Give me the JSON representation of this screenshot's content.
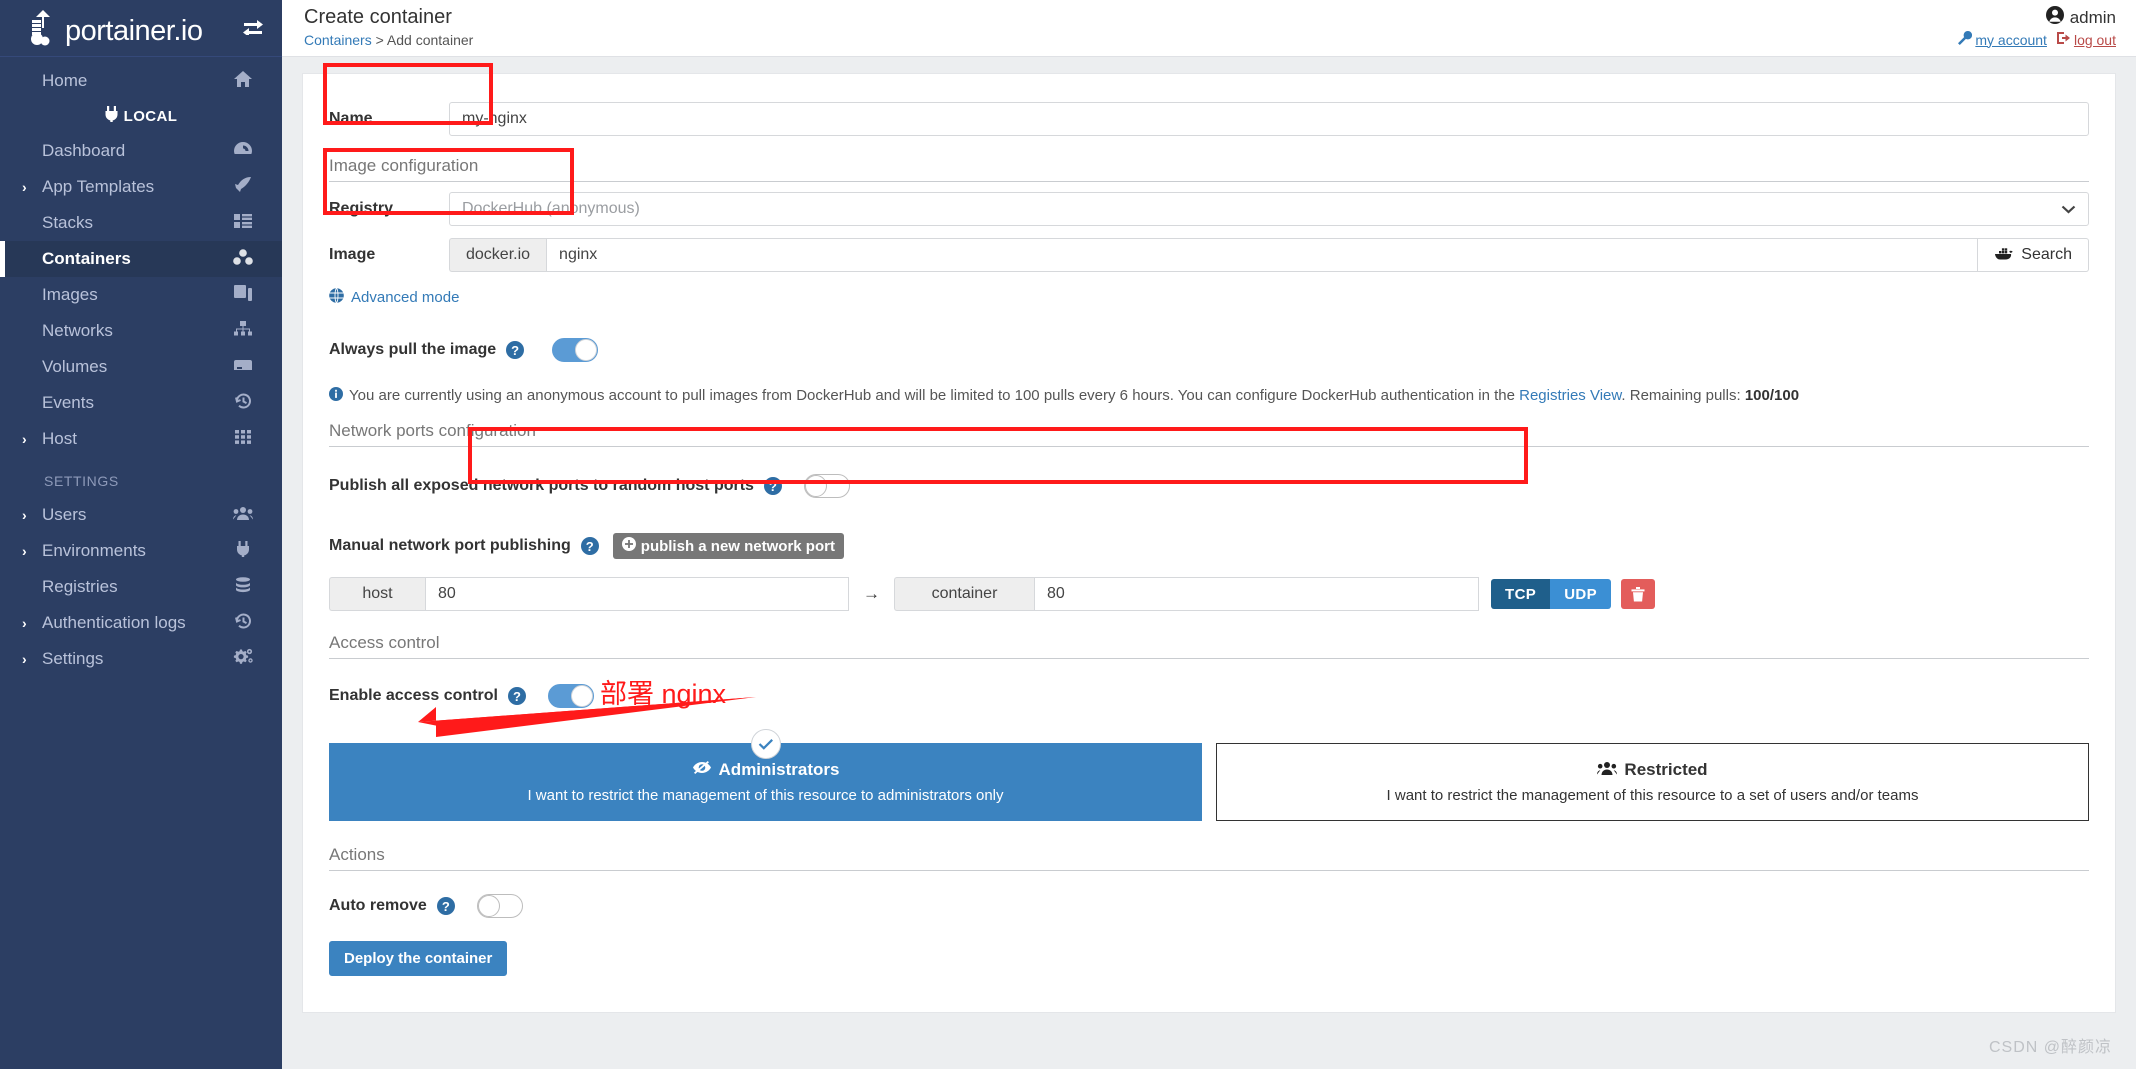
{
  "brand": {
    "name": "portainer.io",
    "toggle_icon": "collapse-arrows-icon"
  },
  "sidebar": {
    "items": [
      {
        "label": "Home",
        "icon": "home-icon",
        "caret": "",
        "active": false
      },
      {
        "label": "LOCAL",
        "icon": "plug-icon",
        "type": "environment"
      },
      {
        "label": "Dashboard",
        "icon": "dashboard-icon",
        "caret": "",
        "active": false
      },
      {
        "label": "App Templates",
        "icon": "rocket-icon",
        "caret": "›",
        "active": false
      },
      {
        "label": "Stacks",
        "icon": "stacks-icon",
        "caret": "",
        "active": false
      },
      {
        "label": "Containers",
        "icon": "containers-icon",
        "caret": "",
        "active": true
      },
      {
        "label": "Images",
        "icon": "images-icon",
        "caret": "",
        "active": false
      },
      {
        "label": "Networks",
        "icon": "networks-icon",
        "caret": "",
        "active": false
      },
      {
        "label": "Volumes",
        "icon": "volumes-icon",
        "caret": "",
        "active": false
      },
      {
        "label": "Events",
        "icon": "history-icon",
        "caret": "",
        "active": false
      },
      {
        "label": "Host",
        "icon": "grid-icon",
        "caret": "›",
        "active": false
      }
    ],
    "section_label": "SETTINGS",
    "settings_items": [
      {
        "label": "Users",
        "icon": "users-icon",
        "caret": "›"
      },
      {
        "label": "Environments",
        "icon": "plug-icon",
        "caret": "›"
      },
      {
        "label": "Registries",
        "icon": "database-icon",
        "caret": ""
      },
      {
        "label": "Authentication logs",
        "icon": "history-icon",
        "caret": "›"
      },
      {
        "label": "Settings",
        "icon": "gears-icon",
        "caret": "›"
      }
    ]
  },
  "header": {
    "title": "Create container",
    "breadcrumb_root": "Containers",
    "breadcrumb_sep": ">",
    "breadcrumb_current": "Add container",
    "user": "admin",
    "my_account": "my account",
    "log_out": "log out"
  },
  "form": {
    "name_label": "Name",
    "name_value": "my-nginx",
    "image_section": "Image configuration",
    "registry_label": "Registry",
    "registry_value": "DockerHub (anonymous)",
    "image_label": "Image",
    "image_prefix": "docker.io",
    "image_value": "nginx",
    "search_label": "Search",
    "advanced_mode": "Advanced mode",
    "always_pull_label": "Always pull the image",
    "always_pull_on": true,
    "info_text_1": "You are currently using an anonymous account to pull images from DockerHub and will be limited to 100 pulls every 6 hours. You can configure DockerHub authentication in the ",
    "info_link": "Registries View",
    "info_text_2": ". Remaining pulls: ",
    "info_pulls": "100/100"
  },
  "ports": {
    "section": "Network ports configuration",
    "publish_all_label": "Publish all exposed network ports to random host ports",
    "publish_all_on": false,
    "manual_label": "Manual network port publishing",
    "publish_new_btn": "publish a new network port",
    "host_addon": "host",
    "host_value": "80",
    "arrow": "→",
    "container_addon": "container",
    "container_value": "80",
    "tcp": "TCP",
    "udp": "UDP",
    "delete_icon": "trash-icon"
  },
  "access": {
    "section": "Access control",
    "enable_label": "Enable access control",
    "enable_on": true,
    "admin_title": "Administrators",
    "admin_sub": "I want to restrict the management of this resource to administrators only",
    "restricted_title": "Restricted",
    "restricted_sub": "I want to restrict the management of this resource to a set of users and/or teams"
  },
  "actions": {
    "section": "Actions",
    "auto_remove_label": "Auto remove",
    "auto_remove_on": false,
    "deploy_label": "Deploy the container"
  },
  "annotation": {
    "text": "部署 nginx",
    "color": "#ff1a1a"
  },
  "watermark": "CSDN @醉颜凉",
  "colors": {
    "sidebar": "#2c3e63",
    "sidebar_active": "#273857",
    "accent": "#3b83c0",
    "link": "#337ab7",
    "danger": "#e35d5b",
    "highlight": "#ff1a1a"
  }
}
